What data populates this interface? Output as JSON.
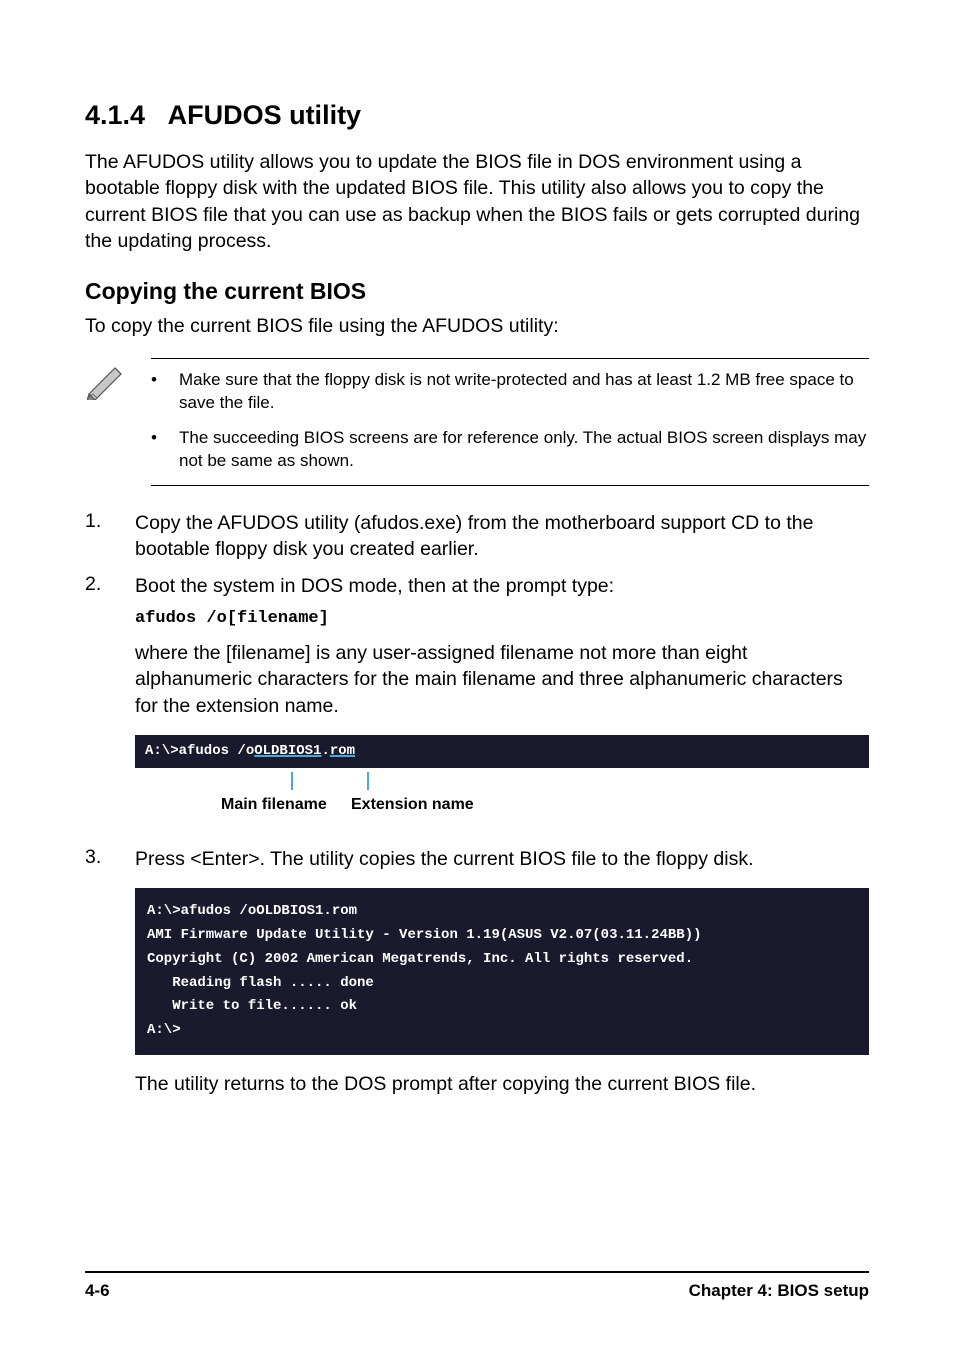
{
  "section": {
    "number": "4.1.4",
    "title": "AFUDOS utility"
  },
  "intro": "The AFUDOS utility allows you to update the BIOS file in DOS environment using a bootable floppy disk with the updated BIOS file. This utility also allows you to copy the current BIOS file that you can use as backup when the BIOS fails or gets corrupted during the updating process.",
  "subheading": "Copying the current BIOS",
  "subbody": "To copy the current BIOS file using the AFUDOS utility:",
  "notes": {
    "bullet1": "Make sure that the floppy disk is not write-protected and has at least 1.2 MB free space to save the file.",
    "bullet2": "The succeeding BIOS screens are for reference only. The actual BIOS screen displays may not be same as shown."
  },
  "steps": {
    "s1": {
      "num": "1.",
      "text": "Copy the AFUDOS utility (afudos.exe) from the motherboard support CD to the bootable floppy disk you created earlier."
    },
    "s2": {
      "num": "2.",
      "text": "Boot the system in DOS mode, then at the prompt type:",
      "code": "afudos /o[filename]",
      "after": "where the [filename] is any user-assigned filename not more than eight alphanumeric characters  for the main filename and three alphanumeric characters for the extension name."
    },
    "s3": {
      "num": "3.",
      "text": "Press <Enter>. The utility copies the current BIOS file to the floppy disk.",
      "after": "The utility returns to the DOS prompt after copying the current BIOS file."
    }
  },
  "terminal1": {
    "prefix": "A:\\>afudos /o",
    "main": "OLDBIOS1",
    "dot": ".",
    "ext": "rom"
  },
  "annotation": {
    "main": "Main filename",
    "ext": "Extension name"
  },
  "terminal2": {
    "l1": "A:\\>afudos /oOLDBIOS1.rom",
    "l2": "AMI Firmware Update Utility - Version 1.19(ASUS V2.07(03.11.24BB))",
    "l3": "Copyright (C) 2002 American Megatrends, Inc. All rights reserved.",
    "l4": "   Reading flash ..... done",
    "l5": "   Write to file...... ok",
    "l6": "A:\\>"
  },
  "footer": {
    "page": "4-6",
    "chapter": "Chapter 4: BIOS setup"
  }
}
